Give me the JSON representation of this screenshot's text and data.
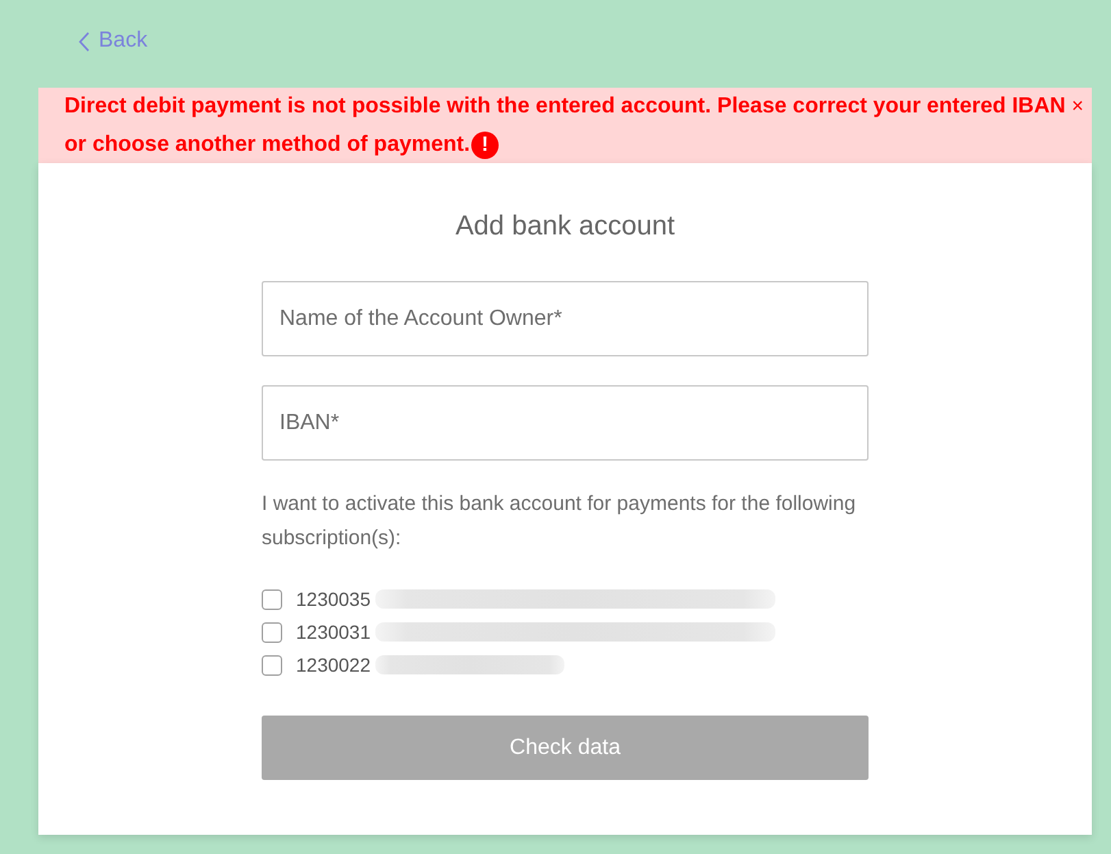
{
  "back_link": {
    "label": "Back"
  },
  "alert": {
    "message": "Direct debit payment is not possible with the entered account. Please correct your entered IBAN or choose another method of payment.",
    "icon": "!",
    "close": "×"
  },
  "form": {
    "title": "Add bank account",
    "fields": [
      {
        "placeholder": "Name of the Account Owner*"
      },
      {
        "placeholder": "IBAN*"
      }
    ],
    "subscriptions_intro": "I want to activate this bank account for payments for the following subscription(s):",
    "subscriptions": [
      {
        "number": "1230035",
        "checked": false
      },
      {
        "number": "1230031",
        "checked": false
      },
      {
        "number": "1230022",
        "checked": false
      }
    ],
    "submit": {
      "label": "Check data",
      "disabled": true
    }
  }
}
